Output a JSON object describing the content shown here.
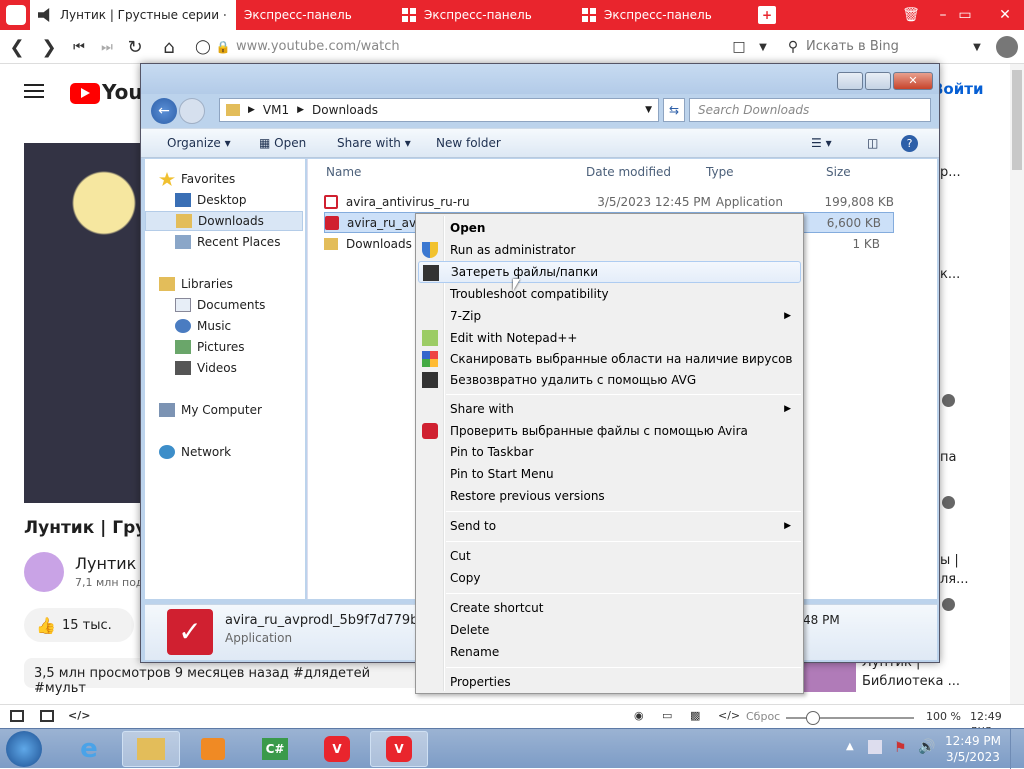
{
  "browser": {
    "tabs": [
      {
        "label": "Лунтик | Грустные серии |"
      },
      {
        "label": "Экспресс-панель"
      },
      {
        "label": "Экспресс-панель"
      },
      {
        "label": "Экспресс-панель"
      }
    ],
    "url": "www.youtube.com/watch",
    "search_placeholder": "Искать в Bing",
    "accent_color": "#e9252d"
  },
  "youtube": {
    "logo_text": "YouTu",
    "signin_label": "Войти",
    "video_title": "Лунтик | Груст",
    "channel_name": "Лунтик",
    "subscribers": "7,1 млн под",
    "likes": "15 тыс.",
    "meta": "3,5 млн просмотров  9 месяцев назад  #длядетей #мульт",
    "side_fragments": [
      "р...",
      "к...",
      "па",
      "ы |",
      "ля...",
      "Лунтик |",
      "Библиотека ..."
    ]
  },
  "explorer": {
    "breadcrumb": [
      "VM1",
      "Downloads"
    ],
    "search_placeholder": "Search Downloads",
    "toolbar": {
      "organize": "Organize",
      "open": "Open",
      "share_with": "Share with",
      "new_folder": "New folder"
    },
    "nav": {
      "favorites": "Favorites",
      "desktop": "Desktop",
      "downloads": "Downloads",
      "recent": "Recent Places",
      "libraries": "Libraries",
      "documents": "Documents",
      "music": "Music",
      "pictures": "Pictures",
      "videos": "Videos",
      "computer": "My Computer",
      "network": "Network"
    },
    "columns": {
      "name": "Name",
      "date": "Date modified",
      "type": "Type",
      "size": "Size"
    },
    "files": [
      {
        "name": "avira_antivirus_ru-ru",
        "date": "3/5/2023 12:45 PM",
        "type": "Application",
        "size": "199,808 KB"
      },
      {
        "name": "avira_ru_avpr",
        "date": "",
        "type": "",
        "size": "6,600 KB"
      },
      {
        "name": "Downloads",
        "date": "",
        "type": "",
        "size": "1 KB"
      }
    ],
    "details": {
      "filename": "avira_ru_avprodl_5b9f7d779b7da",
      "type": "Application",
      "date_fragment": "48 PM"
    }
  },
  "context_menu": {
    "open": "Open",
    "run_admin": "Run as administrator",
    "shred": "Затереть файлы/папки",
    "troubleshoot": "Troubleshoot compatibility",
    "zip": "7-Zip",
    "notepad": "Edit with Notepad++",
    "scan_avg": "Сканировать выбранные области на наличие вирусов",
    "delete_avg": "Безвозвратно удалить с помощью AVG",
    "share_with": "Share with",
    "check_avira": "Проверить выбранные файлы с помощью Avira",
    "pin_taskbar": "Pin to Taskbar",
    "pin_start": "Pin to Start Menu",
    "restore": "Restore previous versions",
    "send_to": "Send to",
    "cut": "Cut",
    "copy": "Copy",
    "shortcut": "Create shortcut",
    "delete": "Delete",
    "rename": "Rename",
    "properties": "Properties"
  },
  "statusbar": {
    "reset": "Сброс",
    "zoom": "100 %",
    "time": "12:49 дня"
  },
  "taskbar": {
    "time": "12:49 PM",
    "date": "3/5/2023"
  }
}
